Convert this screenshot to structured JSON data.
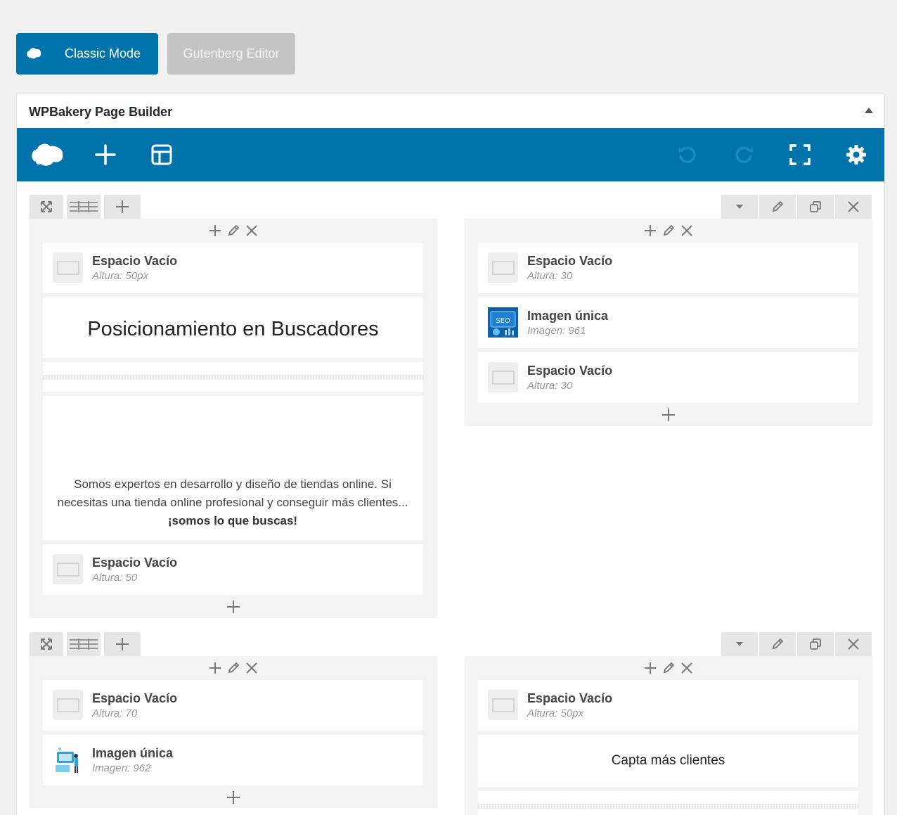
{
  "mode_buttons": {
    "classic": "Classic Mode",
    "gutenberg": "Gutenberg Editor"
  },
  "panel": {
    "title": "WPBakery Page Builder"
  },
  "toolbar": {
    "icons": [
      "wpbakery-logo-icon",
      "add-element-icon",
      "templates-icon",
      "undo-icon",
      "redo-icon",
      "fullscreen-icon",
      "settings-icon"
    ]
  },
  "colors": {
    "brand_blue": "#0073aa",
    "inactive_gray": "#c4c4c4",
    "column_bg": "#f3f3f3"
  },
  "rows": [
    {
      "columns": [
        {
          "elements": [
            {
              "type": "empty-space",
              "title": "Espacio Vacío",
              "subtitle": "Altura: 50px"
            },
            {
              "type": "heading",
              "text": "Posicionamiento en Buscadores"
            },
            {
              "type": "separator"
            },
            {
              "type": "text",
              "text": "Somos expertos en desarrollo y diseño de tiendas online. Si necesitas una tienda online profesional y conseguir más clientes... ",
              "bold": "¡somos lo que buscas!"
            },
            {
              "type": "empty-space",
              "title": "Espacio Vacío",
              "subtitle": "Altura: 50"
            }
          ]
        },
        {
          "elements": [
            {
              "type": "empty-space",
              "title": "Espacio Vacío",
              "subtitle": "Altura: 30"
            },
            {
              "type": "single-image",
              "title": "Imagen única",
              "subtitle": "Imagen: 961",
              "thumb_label": "SEO"
            },
            {
              "type": "empty-space",
              "title": "Espacio Vacío",
              "subtitle": "Altura: 30"
            }
          ]
        }
      ]
    },
    {
      "columns": [
        {
          "elements": [
            {
              "type": "empty-space",
              "title": "Espacio Vacío",
              "subtitle": "Altura: 70"
            },
            {
              "type": "single-image",
              "title": "Imagen única",
              "subtitle": "Imagen: 962"
            }
          ]
        },
        {
          "elements": [
            {
              "type": "empty-space",
              "title": "Espacio Vacío",
              "subtitle": "Altura: 50px"
            },
            {
              "type": "heading-small",
              "text": "Capta más clientes"
            },
            {
              "type": "separator"
            }
          ]
        }
      ]
    }
  ]
}
